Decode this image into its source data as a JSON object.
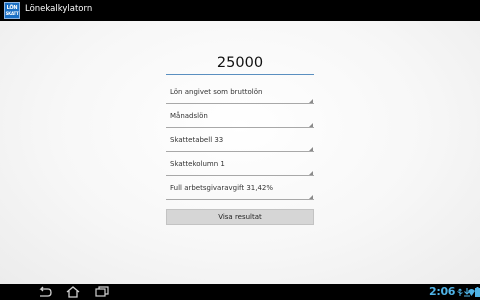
{
  "app": {
    "logo_line1": "LÖN",
    "logo_line2": "SKATT",
    "title": "Lönekalkylatorn"
  },
  "form": {
    "salary_value": "25000",
    "spinners": [
      {
        "label": "Lön angivet som bruttolön"
      },
      {
        "label": "Månadslön"
      },
      {
        "label": "Skattetabell 33"
      },
      {
        "label": "Skattekolumn 1"
      },
      {
        "label": "Full arbetsgivaravgift 31,42%"
      }
    ],
    "submit_label": "Visa resultat"
  },
  "system_bar": {
    "time": "2:06",
    "nav_icons": [
      "back-icon",
      "home-icon",
      "recent-apps-icon"
    ],
    "status_icons": [
      "usb-icon",
      "download-icon",
      "wifi-icon",
      "battery-icon"
    ],
    "accent_color": "#4fb3e6"
  }
}
